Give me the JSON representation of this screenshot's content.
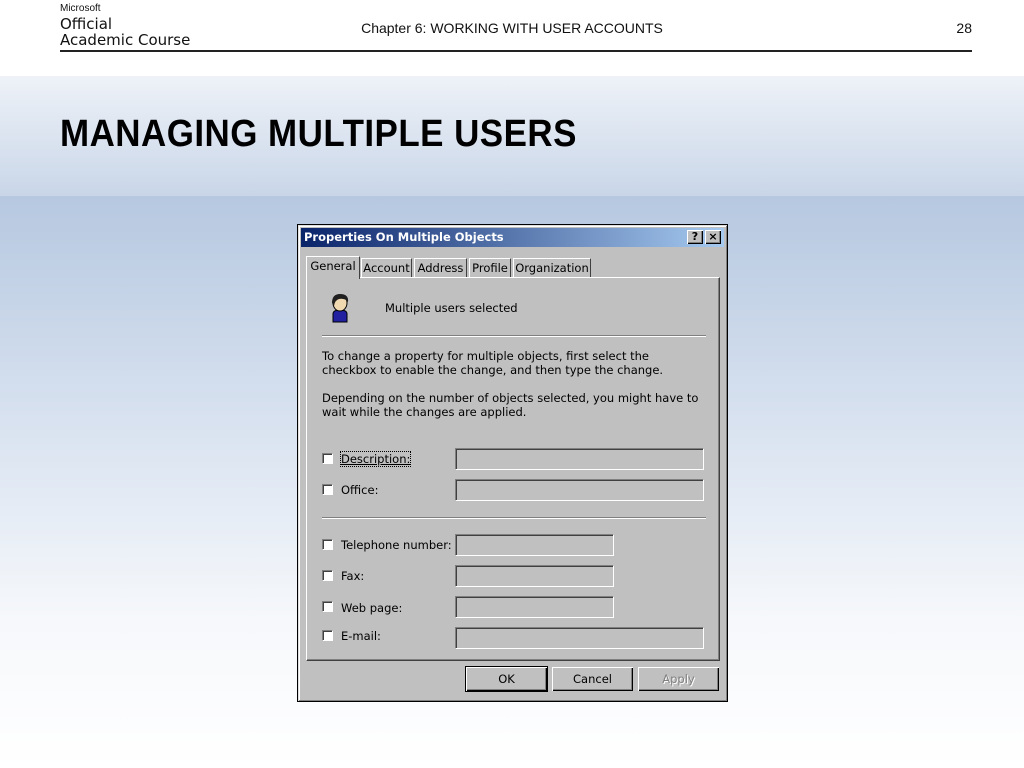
{
  "header": {
    "brand_line0": "Microsoft",
    "brand_line1": "Official",
    "brand_line2": "Academic Course",
    "chapter": "Chapter 6: WORKING WITH USER ACCOUNTS",
    "page_number": "28"
  },
  "slide": {
    "title": "MANAGING MULTIPLE USERS"
  },
  "dialog": {
    "title": "Properties On Multiple Objects",
    "help_button": "?",
    "close_button": "×",
    "tabs": [
      {
        "label": "General"
      },
      {
        "label": "Account"
      },
      {
        "label": "Address"
      },
      {
        "label": "Profile"
      },
      {
        "label": "Organization"
      }
    ],
    "users_icon": "user-icon",
    "selected_text": "Multiple users selected",
    "info1": "To change a property for multiple objects, first select the checkbox to enable the change, and then type the change.",
    "info2": "Depending on the number of objects selected, you might have to wait while the changes are applied.",
    "fields": [
      {
        "label": "Description:",
        "value": "",
        "checked": false
      },
      {
        "label": "Office:",
        "value": "",
        "checked": false
      },
      {
        "label": "Telephone number:",
        "value": "",
        "checked": false
      },
      {
        "label": "Fax:",
        "value": "",
        "checked": false
      },
      {
        "label": "Web page:",
        "value": "",
        "checked": false
      },
      {
        "label": "E-mail:",
        "value": "",
        "checked": false
      }
    ],
    "buttons": {
      "ok": "OK",
      "cancel": "Cancel",
      "apply": "Apply"
    }
  }
}
